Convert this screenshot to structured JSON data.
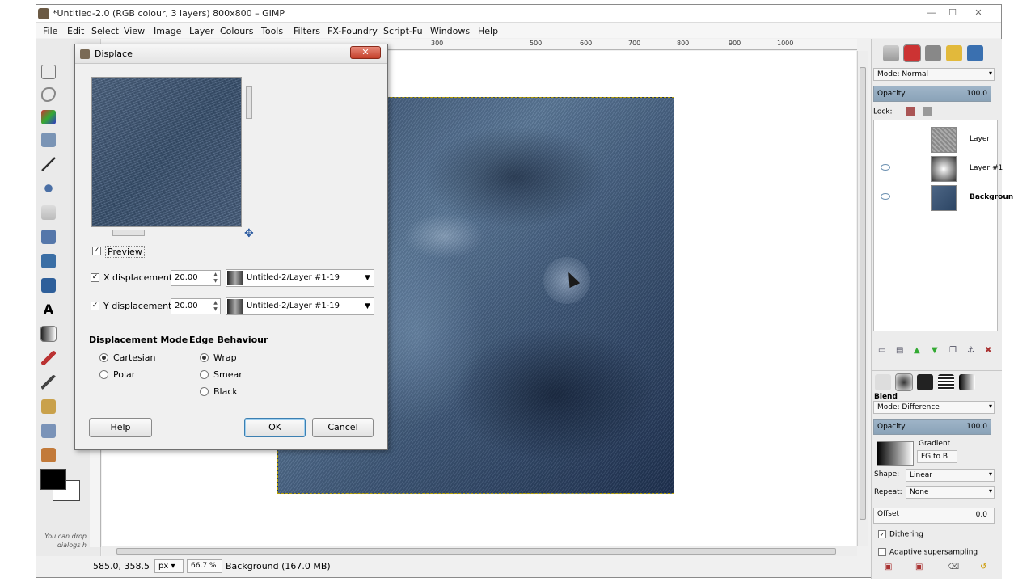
{
  "window": {
    "title": "*Untitled-2.0 (RGB colour, 3 layers) 800x800 – GIMP",
    "controls": {
      "minimize": "—",
      "maximize": "☐",
      "close": "✕"
    }
  },
  "menubar": [
    "File",
    "Edit",
    "Select",
    "View",
    "Image",
    "Layer",
    "Colours",
    "Tools",
    "Filters",
    "FX-Foundry",
    "Script-Fu",
    "Windows",
    "Help"
  ],
  "ruler": {
    "ticks": [
      "300",
      "500",
      "600",
      "700",
      "800",
      "900",
      "1000"
    ]
  },
  "toolbox": {
    "drop_hint": "You can drop dialogs h"
  },
  "statusbar": {
    "coords": "585.0, 358.5",
    "unit": "px",
    "zoom": "66.7 %",
    "message": "Background (167.0 MB)"
  },
  "dialog": {
    "title": "Displace",
    "close": "✕",
    "preview_label": "Preview",
    "preview_checked": true,
    "x_displacement": {
      "label": "X displacement",
      "value": "20.00",
      "map": "Untitled-2/Layer #1-19",
      "checked": true
    },
    "y_displacement": {
      "label": "Y displacement",
      "value": "20.00",
      "map": "Untitled-2/Layer #1-19",
      "checked": true
    },
    "displacement_mode": {
      "title": "Displacement Mode",
      "options": [
        "Cartesian",
        "Polar"
      ],
      "selected": "Cartesian"
    },
    "edge_behaviour": {
      "title": "Edge Behaviour",
      "options": [
        "Wrap",
        "Smear",
        "Black"
      ],
      "selected": "Wrap"
    },
    "buttons": {
      "help": "Help",
      "ok": "OK",
      "cancel": "Cancel"
    }
  },
  "layers_panel": {
    "mode_label": "Mode: Normal",
    "opacity_label": "Opacity",
    "opacity_value": "100.0",
    "lock_label": "Lock:",
    "layers": [
      {
        "name": "Layer",
        "visible": false
      },
      {
        "name": "Layer #1",
        "visible": true
      },
      {
        "name": "Backgroun",
        "visible": true,
        "active": true
      }
    ]
  },
  "tool_options": {
    "tool_name": "Blend",
    "mode_label": "Mode: Difference",
    "opacity_label": "Opacity",
    "opacity_value": "100.0",
    "gradient_label": "Gradient",
    "gradient_value": "FG to B",
    "shape_label": "Shape:",
    "shape_value": "Linear",
    "repeat_label": "Repeat:",
    "repeat_value": "None",
    "offset_label": "Offset",
    "offset_value": "0.0",
    "dithering_label": "Dithering",
    "dithering_checked": true,
    "adaptive_label": "Adaptive supersampling",
    "adaptive_checked": false
  },
  "colors": {
    "accent": "#3c7fb1",
    "close_button": "#c4402a",
    "opacity_bar": "#9fb5c8"
  }
}
